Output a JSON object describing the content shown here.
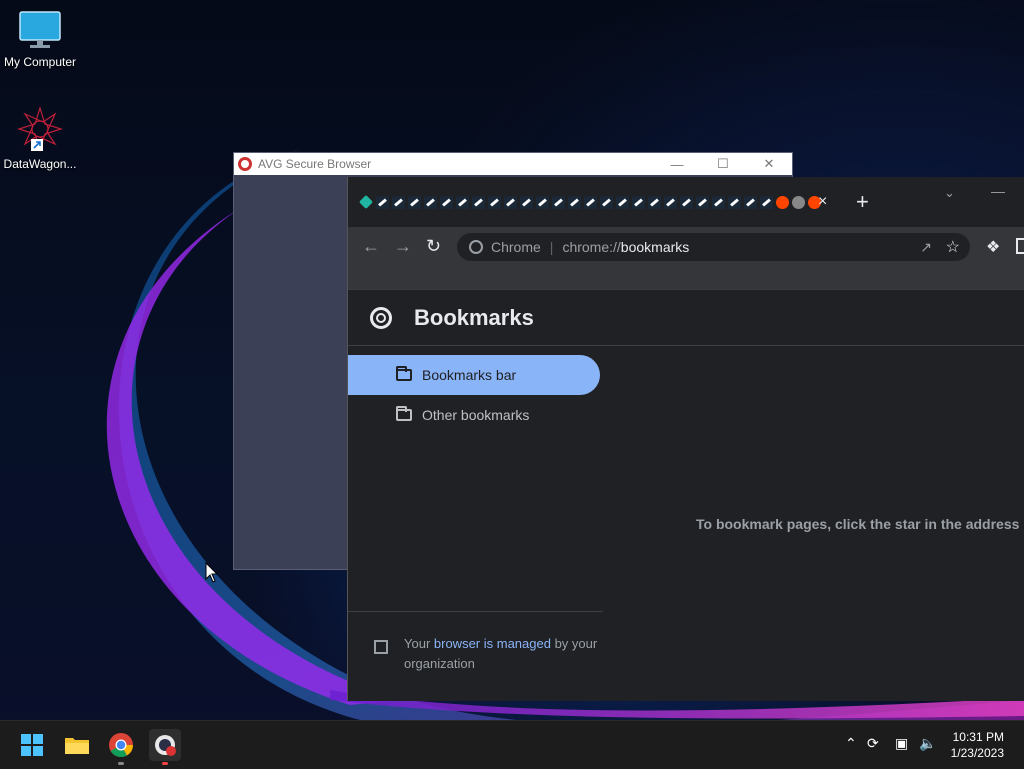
{
  "desktop": {
    "icons": [
      {
        "label": "My Computer"
      },
      {
        "label": "DataWagon..."
      }
    ]
  },
  "avg_window": {
    "title": "AVG Secure Browser"
  },
  "chrome": {
    "tab_close": "×",
    "new_tab": "+",
    "address": {
      "site_label": "Chrome",
      "url_prefix": "chrome://",
      "url_host": "bookmarks"
    },
    "page_title": "Bookmarks",
    "folders": [
      {
        "label": "Bookmarks bar",
        "selected": true
      },
      {
        "label": "Other bookmarks",
        "selected": false
      }
    ],
    "empty_message": "To bookmark pages, click the star in the address bar",
    "managed": {
      "prefix": "Your ",
      "link": "browser is managed",
      "suffix": " by your organization"
    }
  },
  "taskbar": {
    "time": "10:31 PM",
    "date": "1/23/2023"
  }
}
